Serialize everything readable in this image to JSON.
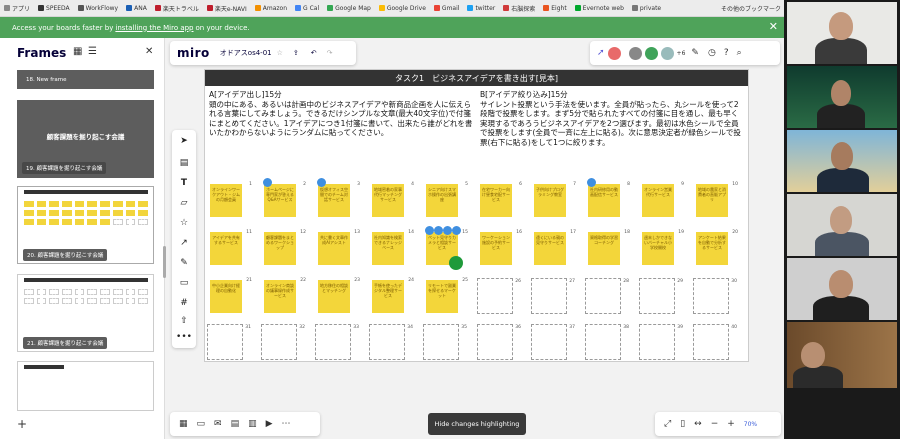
{
  "bookmarks": {
    "items": [
      "アプリ",
      "SPEEDA",
      "WorkFlowy",
      "ANA",
      "楽天トラベル",
      "楽天e-NAVI",
      "Amazon",
      "G Cal",
      "Google Map",
      "Google Drive",
      "Gmail",
      "twitter",
      "右脳探索",
      "Eight",
      "Evernote web",
      "private"
    ],
    "other": "その他のブックマーク"
  },
  "banner": {
    "text_before": "Access your boards faster by",
    "link": "installing the Miro app",
    "text_after": "on your device."
  },
  "frames_panel": {
    "title": "Frames",
    "items": [
      {
        "label": "18. New frame"
      },
      {
        "label": "19. 顧客課題を掘り起こす会議",
        "heading": "顧客課題を掘り起こす会議"
      },
      {
        "label": "20. 顧客課題を掘り起こす会議"
      },
      {
        "label": "21. 顧客課題を掘り起こす会議"
      }
    ]
  },
  "board": {
    "logo": "miro",
    "name": "オドアスos4-01",
    "participant_count": "+6"
  },
  "frame": {
    "title": "タスク1　ビジネスアイデアを書き出す[見本]",
    "left_heading": "A[アイデア出し]15分",
    "left_body": "頭の中にある、あるいは計画中のビジネスアイデアや新商品企画を人に伝えられる言葉にしてみましょう。できるだけシンプルな文章(最大40文字位)で付箋にまとめてください。1アイデアにつき1付箋に書いて、出来たら誰がどれを書いたかわからないようにランダムに貼ってください。",
    "right_heading": "B[アイデア絞り込み]15分",
    "right_body": "サイレント投票という手法を使います。全員が貼ったら、丸シールを使って2段階で投票をします。まず5分で貼られたすべての付箋に目を通し、最も早く実現するであろうビジネスアイデアを2つ選びます。最初は水色シールで全員で投票をします(全員で一斉に左上に貼る)。次に意思決定者が緑色シールで投票(右下に貼る)をして1つに絞ります。",
    "notes": [
      "オンラインワークアウト・ジムの月額会員",
      "ホームページに専門家が答えるQ&Aサービス",
      "仮想オフィス空間でのチーム対話サービス",
      "地域密着の家事代行マッチングサービス",
      "シニア向けスマホ操作の出張講座",
      "在宅ワーカー向け昼食宅配サービス",
      "子供向けプログラミング教室",
      "社内研修用の動画配信サービス",
      "オンライン営業代行サービス",
      "地域の農家と消費者の直販アプリ",
      "アイデアを共有するサービス",
      "顧客課題をまとめるワークショップ",
      "共に書く文章作成AIアシスト",
      "社内知識を検索できるナレッジベース",
      "ペット見守りカメラと相談サービス",
      "ワーケーション施設の予約サービス",
      "遠くにいる親の見守りサービス",
      "資格取得の学習コーチング",
      "週末しかできないバーチャル小学校開校",
      "アンケート結果を自動で分析するサービス",
      "中小企業向け経理の自動化",
      "オンライン商談の議事録作成サービス",
      "地方移住の相談とマッチング",
      "手帳を使ったデジタル整理サービス",
      "リモートで副業を探せるマーケット",
      "子育て世代向け時短レシピ配信",
      "社員の健康管理アプリ"
    ]
  },
  "bottom": {
    "hide_changes": "Hide changes highlighting",
    "zoom": "70%"
  },
  "colors": {
    "banner": "#4fa35a",
    "sticky": "#f3d63a",
    "vote_blue": "#3f8fe0",
    "vote_green": "#1f9a3a"
  }
}
